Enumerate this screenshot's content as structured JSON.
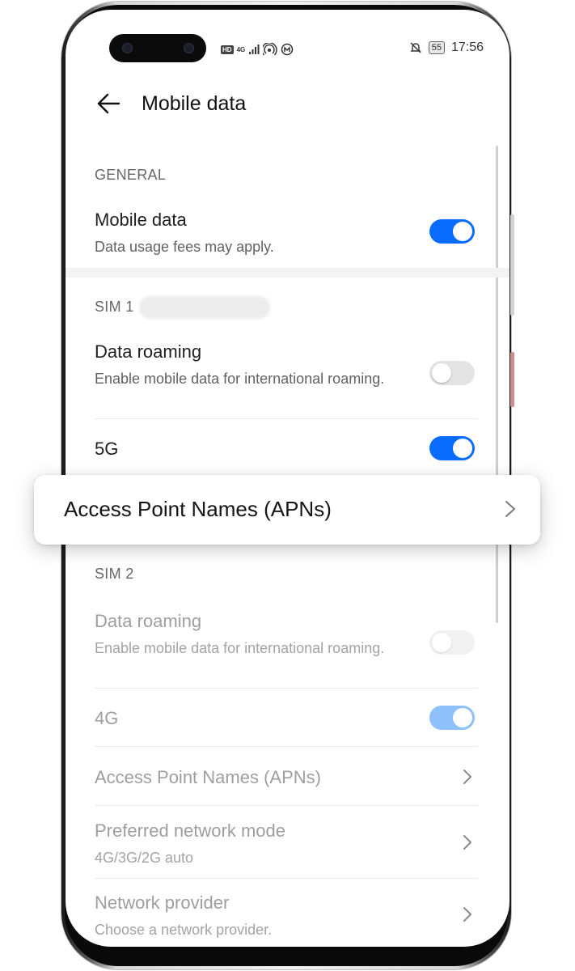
{
  "status_bar": {
    "hd": "HD",
    "network": "4G",
    "battery": "55",
    "time": "17:56"
  },
  "header": {
    "title": "Mobile data"
  },
  "general": {
    "section_label": "GENERAL",
    "mobile_data": {
      "label": "Mobile data",
      "sub": "Data usage fees may apply.",
      "on": true
    }
  },
  "sim1": {
    "section_label": "SIM 1",
    "data_roaming": {
      "label": "Data roaming",
      "sub": "Enable mobile data for international roaming.",
      "on": false
    },
    "fiveg": {
      "label": "5G",
      "on": true
    },
    "apn_label": "Access Point Names (APNs)"
  },
  "sim2": {
    "section_label": "SIM 2",
    "data_roaming": {
      "label": "Data roaming",
      "sub": "Enable mobile data for international roaming.",
      "on": false
    },
    "fourg": {
      "label": "4G",
      "on": true
    },
    "apn_label": "Access Point Names (APNs)",
    "preferred_mode": {
      "label": "Preferred network mode",
      "sub": "4G/3G/2G auto"
    },
    "provider": {
      "label": "Network provider",
      "sub": "Choose a network provider."
    }
  },
  "colors": {
    "accent": "#0a6cff",
    "accent_dim": "#8ec0fb"
  }
}
